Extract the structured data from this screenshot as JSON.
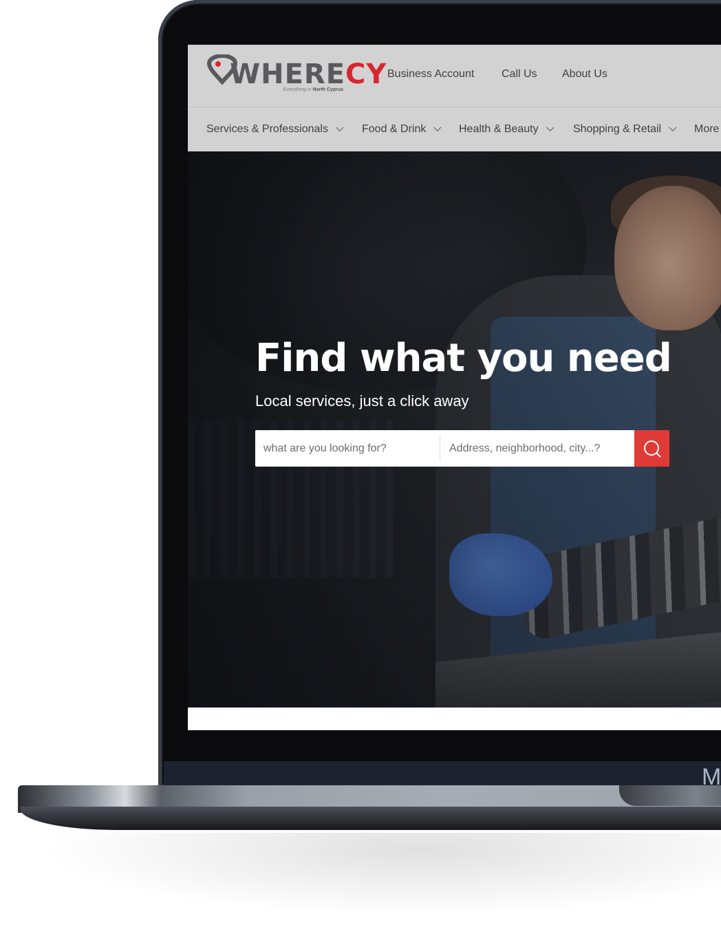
{
  "brand": {
    "logo_text_main": "WHERE",
    "logo_text_accent": "CY",
    "tagline_prefix": "Everything in",
    "tagline_location": "North Cyprus"
  },
  "topnav": {
    "items": [
      "Business Account",
      "Call Us",
      "About Us"
    ]
  },
  "categories": {
    "items": [
      "Services & Professionals",
      "Food & Drink",
      "Health & Beauty",
      "Shopping & Retail",
      "More"
    ]
  },
  "hero": {
    "title": "Find what you need",
    "subtitle": "Local services, just a click away"
  },
  "search": {
    "what_placeholder": "what are you looking for?",
    "where_placeholder": "Address, neighborhood, city...?",
    "button_icon": "search-icon"
  },
  "device": {
    "bezel_logo": "M"
  },
  "colors": {
    "accent": "#d8262e",
    "search_button": "#e03a36",
    "header_bg": "#d2d2d3"
  }
}
